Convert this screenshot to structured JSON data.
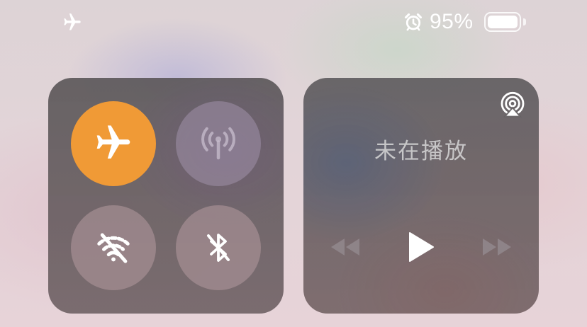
{
  "status_bar": {
    "battery_percent": "95%",
    "battery_level": 0.95,
    "icons": [
      "airplane-icon",
      "alarm-icon",
      "battery-icon"
    ]
  },
  "connectivity": {
    "toggles": [
      {
        "name": "airplane-mode",
        "icon": "airplane-icon",
        "state": "on",
        "color": "#f09a36"
      },
      {
        "name": "cellular-data",
        "icon": "antenna-icon",
        "state": "disabled"
      },
      {
        "name": "wifi",
        "icon": "wifi-off-icon",
        "state": "off"
      },
      {
        "name": "bluetooth",
        "icon": "bluetooth-off-icon",
        "state": "off"
      }
    ]
  },
  "media": {
    "status_text": "未在播放",
    "icons": [
      "airplay-icon",
      "rewind-icon",
      "play-icon",
      "fast-forward-icon"
    ]
  },
  "colors": {
    "accent_orange": "#f09a36",
    "panel_dark": "#5c585a"
  }
}
